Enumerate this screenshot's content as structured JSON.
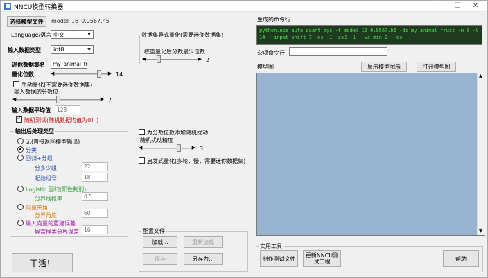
{
  "window": {
    "title": "NNCU模型转换器",
    "minimize": "—",
    "maximize": "☐",
    "close": "✕"
  },
  "model": {
    "select_button": "选择模型文件",
    "filename": "model_16_0.9567.h5"
  },
  "language": {
    "label": "Language/语言",
    "value": "中文"
  },
  "input_type": {
    "label": "输入数据类型",
    "value": "int8"
  },
  "dataset_name": {
    "label": "迷你数据集名",
    "value": "my_animal_fruit"
  },
  "quant_bits": {
    "label": "量化位数",
    "value": 14,
    "display": "14",
    "level": 0.9
  },
  "manual_quant": {
    "label": "手动量化(不需要迷你数据集)",
    "checked": false
  },
  "frac_bits": {
    "label": "输入数据的分数位",
    "value": 7,
    "display": "7",
    "level": 0.5
  },
  "input_mean": {
    "label": "输入数据平均值",
    "value": "128"
  },
  "random_test": {
    "label": "随机测试(随机数据均值为0！)",
    "checked": true
  },
  "output_post": {
    "group_label": "输出后处理类型",
    "options": [
      {
        "label": "无(直接返回模型输出)",
        "selected": false
      },
      {
        "label": "分类",
        "selected": true
      },
      {
        "label": "回归+分组",
        "selected": false
      },
      {
        "label": "Logistic 回归(阳性判别)",
        "selected": false
      },
      {
        "label": "向量夹角",
        "selected": false
      },
      {
        "label": "输入向量的重建误差",
        "selected": false
      }
    ],
    "regression": {
      "group_size_label": "分多少组",
      "group_size": "22",
      "start_label": "起始组号",
      "start": "18"
    },
    "logistic": {
      "threshold_label": "分界线概率",
      "threshold": "0.5"
    },
    "vector": {
      "threshold_label": "分界角度",
      "threshold": "60"
    },
    "recon": {
      "threshold_label": "异常样本分界误差",
      "threshold": "16"
    }
  },
  "dataset_format": {
    "group_label": "数据集导式量化(需要迷你数据集)",
    "min_frac_label": "权重量化后分数最少位数",
    "min_frac": 2,
    "min_frac_display": "2",
    "level": 0.2
  },
  "random_weight": {
    "label": "为分数位数添加随机扰动",
    "checked": false
  },
  "random_precision": {
    "label": "随机扰动精度",
    "value": 3,
    "display": "3",
    "level": 0.8
  },
  "heuristic": {
    "label": "启发式量化(多轮，慢，需要迷你数据集)",
    "checked": false
  },
  "run_button": "干活！",
  "config": {
    "group_label": "配置文件",
    "load": "加载...",
    "reload": "重新加载",
    "save": "保存",
    "save_as": "另存为..."
  },
  "command": {
    "label": "生成的命令行",
    "text": "python.exe auto_quant.pyc -f model_16_0.9567.h5 -ds my_animal_fruit -m 0 -l 14 --input_shift 7 -as -1 -zs2 -1 --ws_min 2 --ds"
  },
  "extra_args": {
    "label": "杂项命令行",
    "value": ""
  },
  "model_diagram": {
    "label": "模型图",
    "show_button": "显示模型图示",
    "open_button": "打开模型图"
  },
  "tools": {
    "group_label": "实用工具",
    "make_test": "制作测试文件",
    "update_nncu": "更新NNCU测试工程",
    "help": "帮助"
  },
  "colors": {
    "preview_bg": "#99b4d1",
    "cmd_bg": "#1f3b1f",
    "cmd_fg": "#4ee14e",
    "random_test_label": "#cc0000",
    "regression": "#2b50b0",
    "logistic": "#2a9b2a",
    "vector": "#e07a00",
    "recon": "#a020a0"
  }
}
